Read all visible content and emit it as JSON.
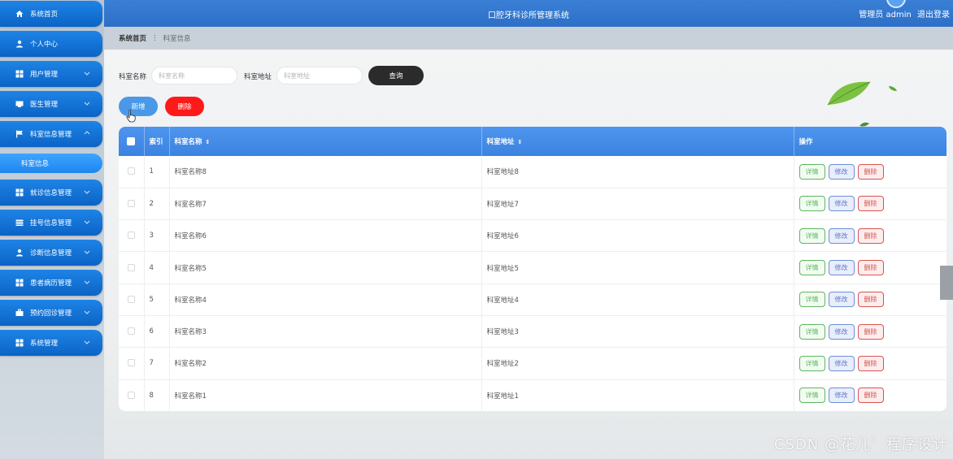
{
  "sidebar": {
    "items": [
      {
        "label": "系统首页",
        "icon": "home-icon"
      },
      {
        "label": "个人中心",
        "icon": "user-icon"
      },
      {
        "label": "用户管理",
        "icon": "grid-icon"
      },
      {
        "label": "医生管理",
        "icon": "card-icon"
      },
      {
        "label": "科室信息管理",
        "icon": "flag-icon"
      },
      {
        "label": "就诊信息管理",
        "icon": "grid-icon"
      },
      {
        "label": "挂号信息管理",
        "icon": "list-icon"
      },
      {
        "label": "诊断信息管理",
        "icon": "user-icon"
      },
      {
        "label": "患者病历管理",
        "icon": "grid-icon"
      },
      {
        "label": "预约回诊管理",
        "icon": "briefcase-icon"
      },
      {
        "label": "系统管理",
        "icon": "grid-icon"
      }
    ],
    "sub_item": "科室信息"
  },
  "header": {
    "title": "口腔牙科诊所管理系统",
    "user": "管理员 admin",
    "logout": "退出登录"
  },
  "breadcrumb": {
    "home": "系统首页",
    "current": "科室信息"
  },
  "search": {
    "name_label": "科室名称",
    "name_placeholder": "科室名称",
    "address_label": "科室地址",
    "address_placeholder": "科室地址",
    "query_button": "查询"
  },
  "actions": {
    "add": "新增",
    "delete": "删除"
  },
  "table": {
    "columns": [
      "索引",
      "科室名称",
      "科室地址",
      "操作"
    ],
    "rows": [
      {
        "index": "1",
        "name": "科室名称8",
        "address": "科室地址8"
      },
      {
        "index": "2",
        "name": "科室名称7",
        "address": "科室地址7"
      },
      {
        "index": "3",
        "name": "科室名称6",
        "address": "科室地址6"
      },
      {
        "index": "4",
        "name": "科室名称5",
        "address": "科室地址5"
      },
      {
        "index": "5",
        "name": "科室名称4",
        "address": "科室地址4"
      },
      {
        "index": "6",
        "name": "科室名称3",
        "address": "科室地址3"
      },
      {
        "index": "7",
        "name": "科室名称2",
        "address": "科室地址2"
      },
      {
        "index": "8",
        "name": "科室名称1",
        "address": "科室地址1"
      }
    ],
    "ops": {
      "detail": "详情",
      "edit": "修改",
      "delete": "删除"
    }
  },
  "watermark": "CSDN @花儿゜程序设计",
  "colors": {
    "header": "#3a7fd6",
    "nav": "#0b63c6",
    "table_header": "#4e95ee",
    "query_button": "#2b2b2b",
    "add_button": "#4a98e8",
    "delete_button": "#ff1a1a"
  }
}
